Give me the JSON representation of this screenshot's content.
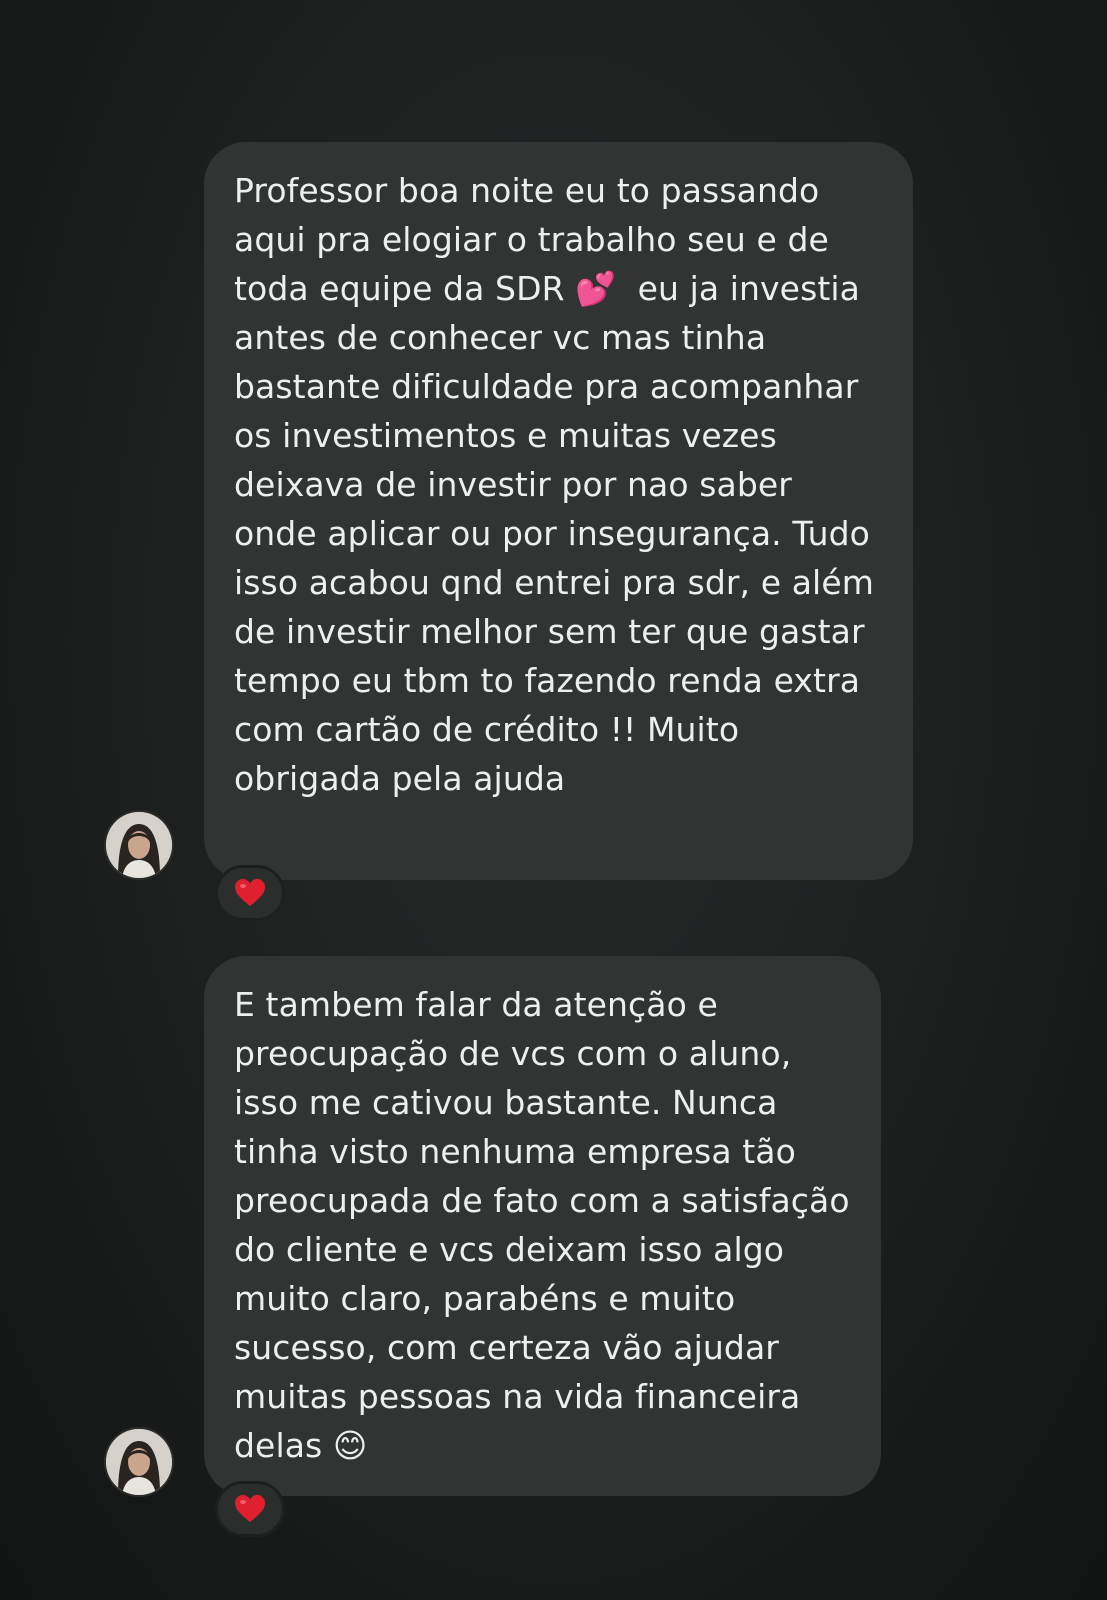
{
  "messages": [
    {
      "text": "Professor boa noite eu to passando aqui pra elogiar o trabalho seu e de toda equipe da SDR 💕  eu ja investia antes de conhecer vc mas tinha bastante dificuldade pra acompanhar os investimentos e muitas vezes deixava de investir por nao saber onde aplicar ou por insegurança. Tudo isso acabou qnd entrei pra sdr, e além de investir melhor sem ter que gastar tempo eu tbm to fazendo renda extra com cartão de crédito !! Muito obrigada pela ajuda",
      "reaction": "heart-icon"
    },
    {
      "text": "E tambem falar da atenção e preocupação de vcs com o aluno, isso me cativou bastante. Nunca tinha visto nenhuma empresa tão preocupada de fato com a satisfação do cliente e vcs deixam isso algo muito claro, parabéns e muito sucesso, com certeza vão ajudar muitas pessoas na vida financeira delas 😊",
      "reaction": "heart-icon"
    }
  ],
  "colors": {
    "background": "#1c1f1e",
    "bubble": "#303432",
    "text": "#eeeeee",
    "reaction_heart": "#e0202e"
  }
}
